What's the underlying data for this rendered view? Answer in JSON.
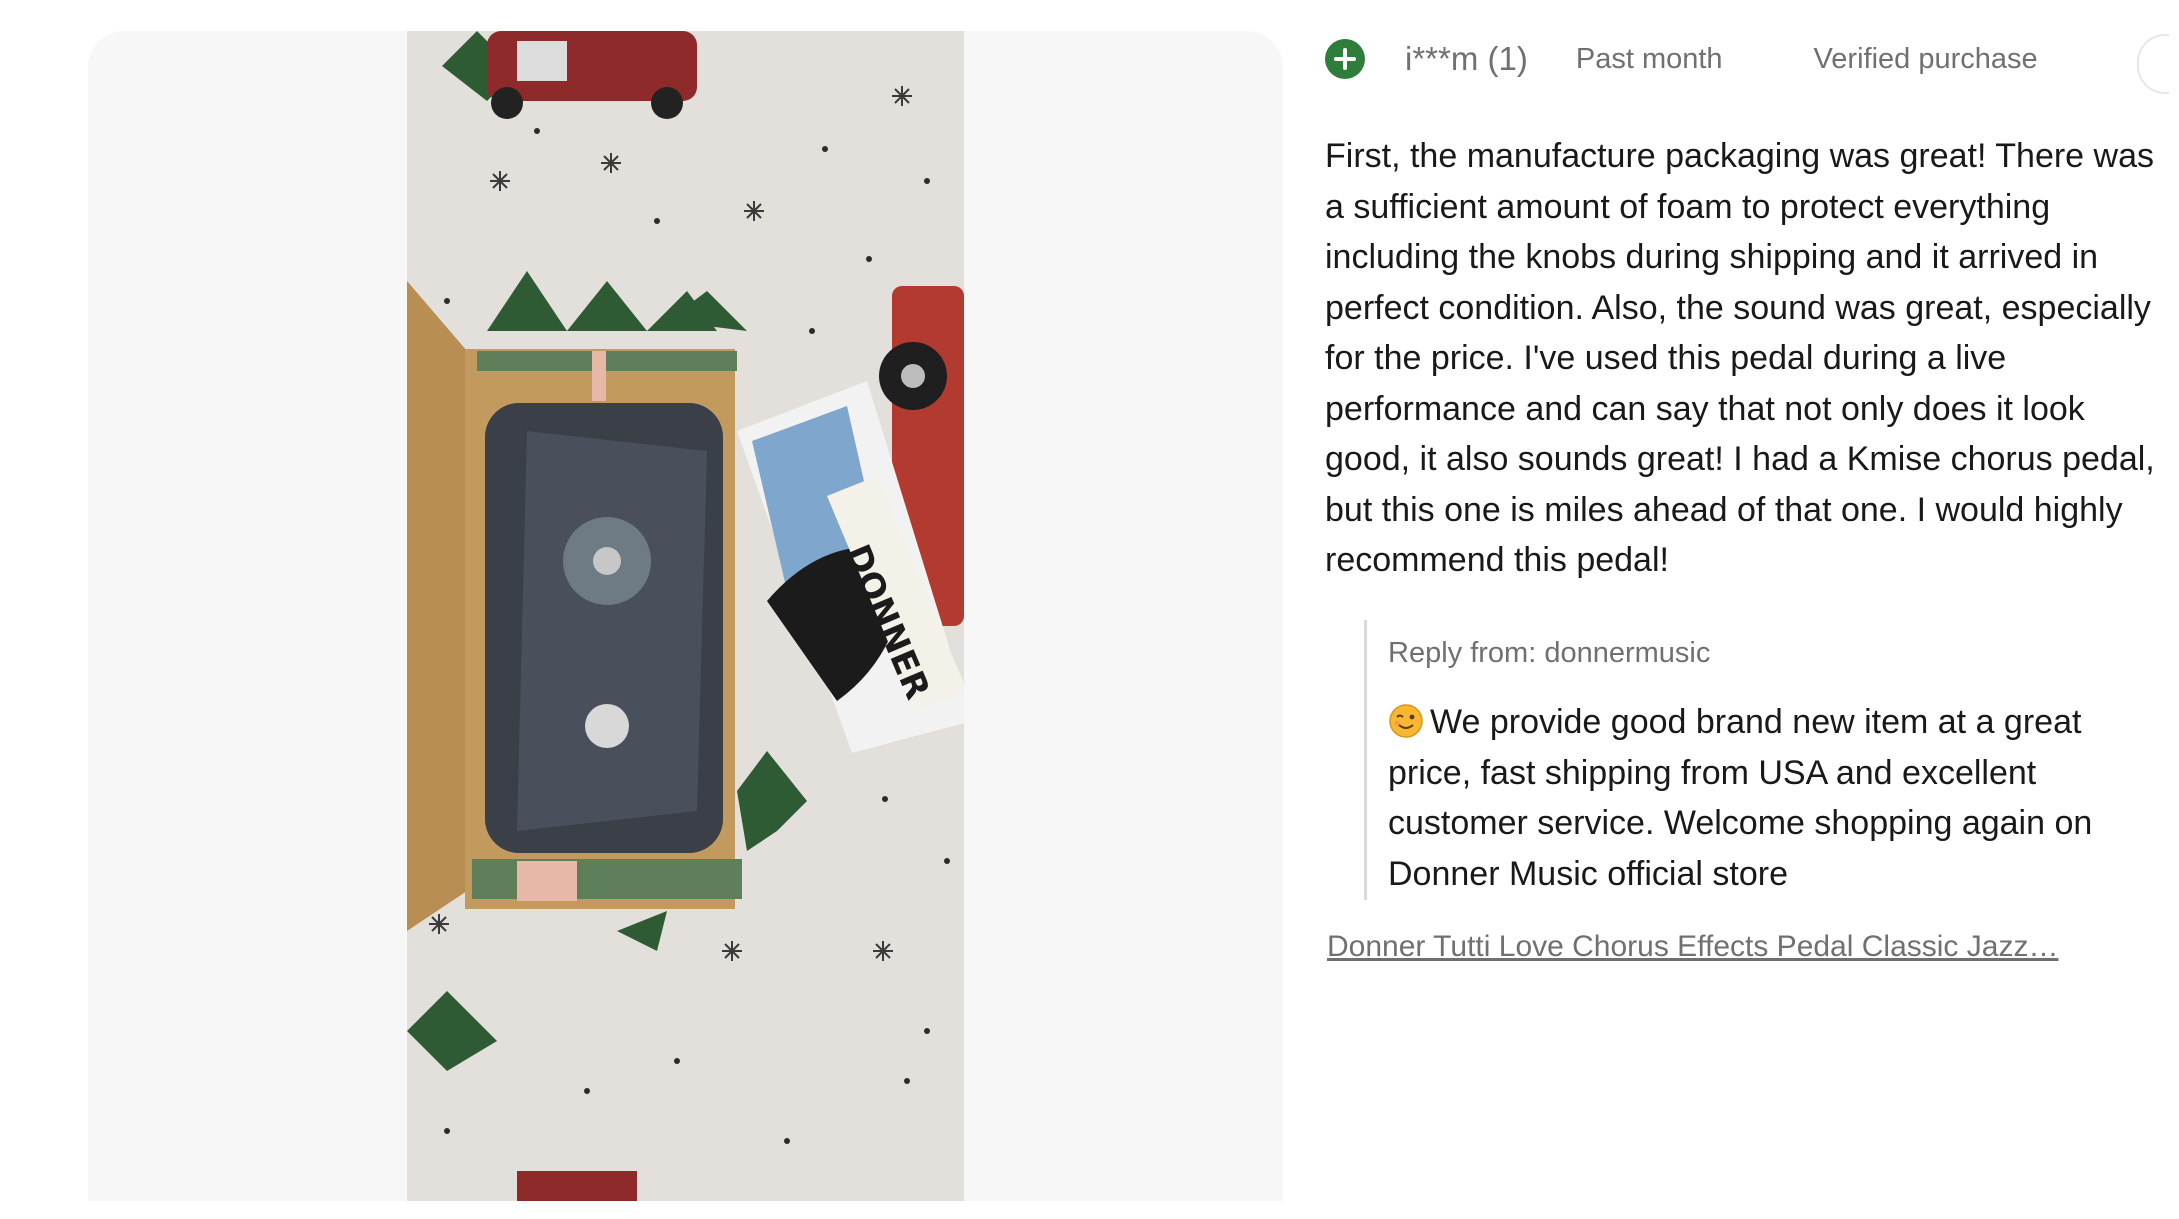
{
  "photo": {
    "description_icon": "product-photo-icon",
    "brand_text": "DONNER"
  },
  "review": {
    "reviewer": "i***m (1)",
    "date": "Past month",
    "verified": "Verified purchase",
    "text": "First, the manufacture packaging was great! There was a sufficient amount of foam to protect everything including the knobs during shipping and it arrived in perfect condition. Also, the sound was great, especially for the price. I've used this pedal during a live performance and can say that not only does it look good, it also sounds great! I had a Kmise chorus pedal, but this one is miles ahead of that one. I would highly recommend this pedal!"
  },
  "reply": {
    "label": "Reply from: donnermusic",
    "emoji_icon": "winking-face-icon",
    "text": "We provide good brand new item at a great price, fast shipping from USA and excellent customer service. Welcome shopping again on Donner Music official store"
  },
  "product_link": "Donner Tutti Love Chorus Effects Pedal Classic Jazz…",
  "colors": {
    "accent_green": "#2f7d3b",
    "meta_gray": "#707070",
    "panel_bg": "#f7f7f7"
  }
}
